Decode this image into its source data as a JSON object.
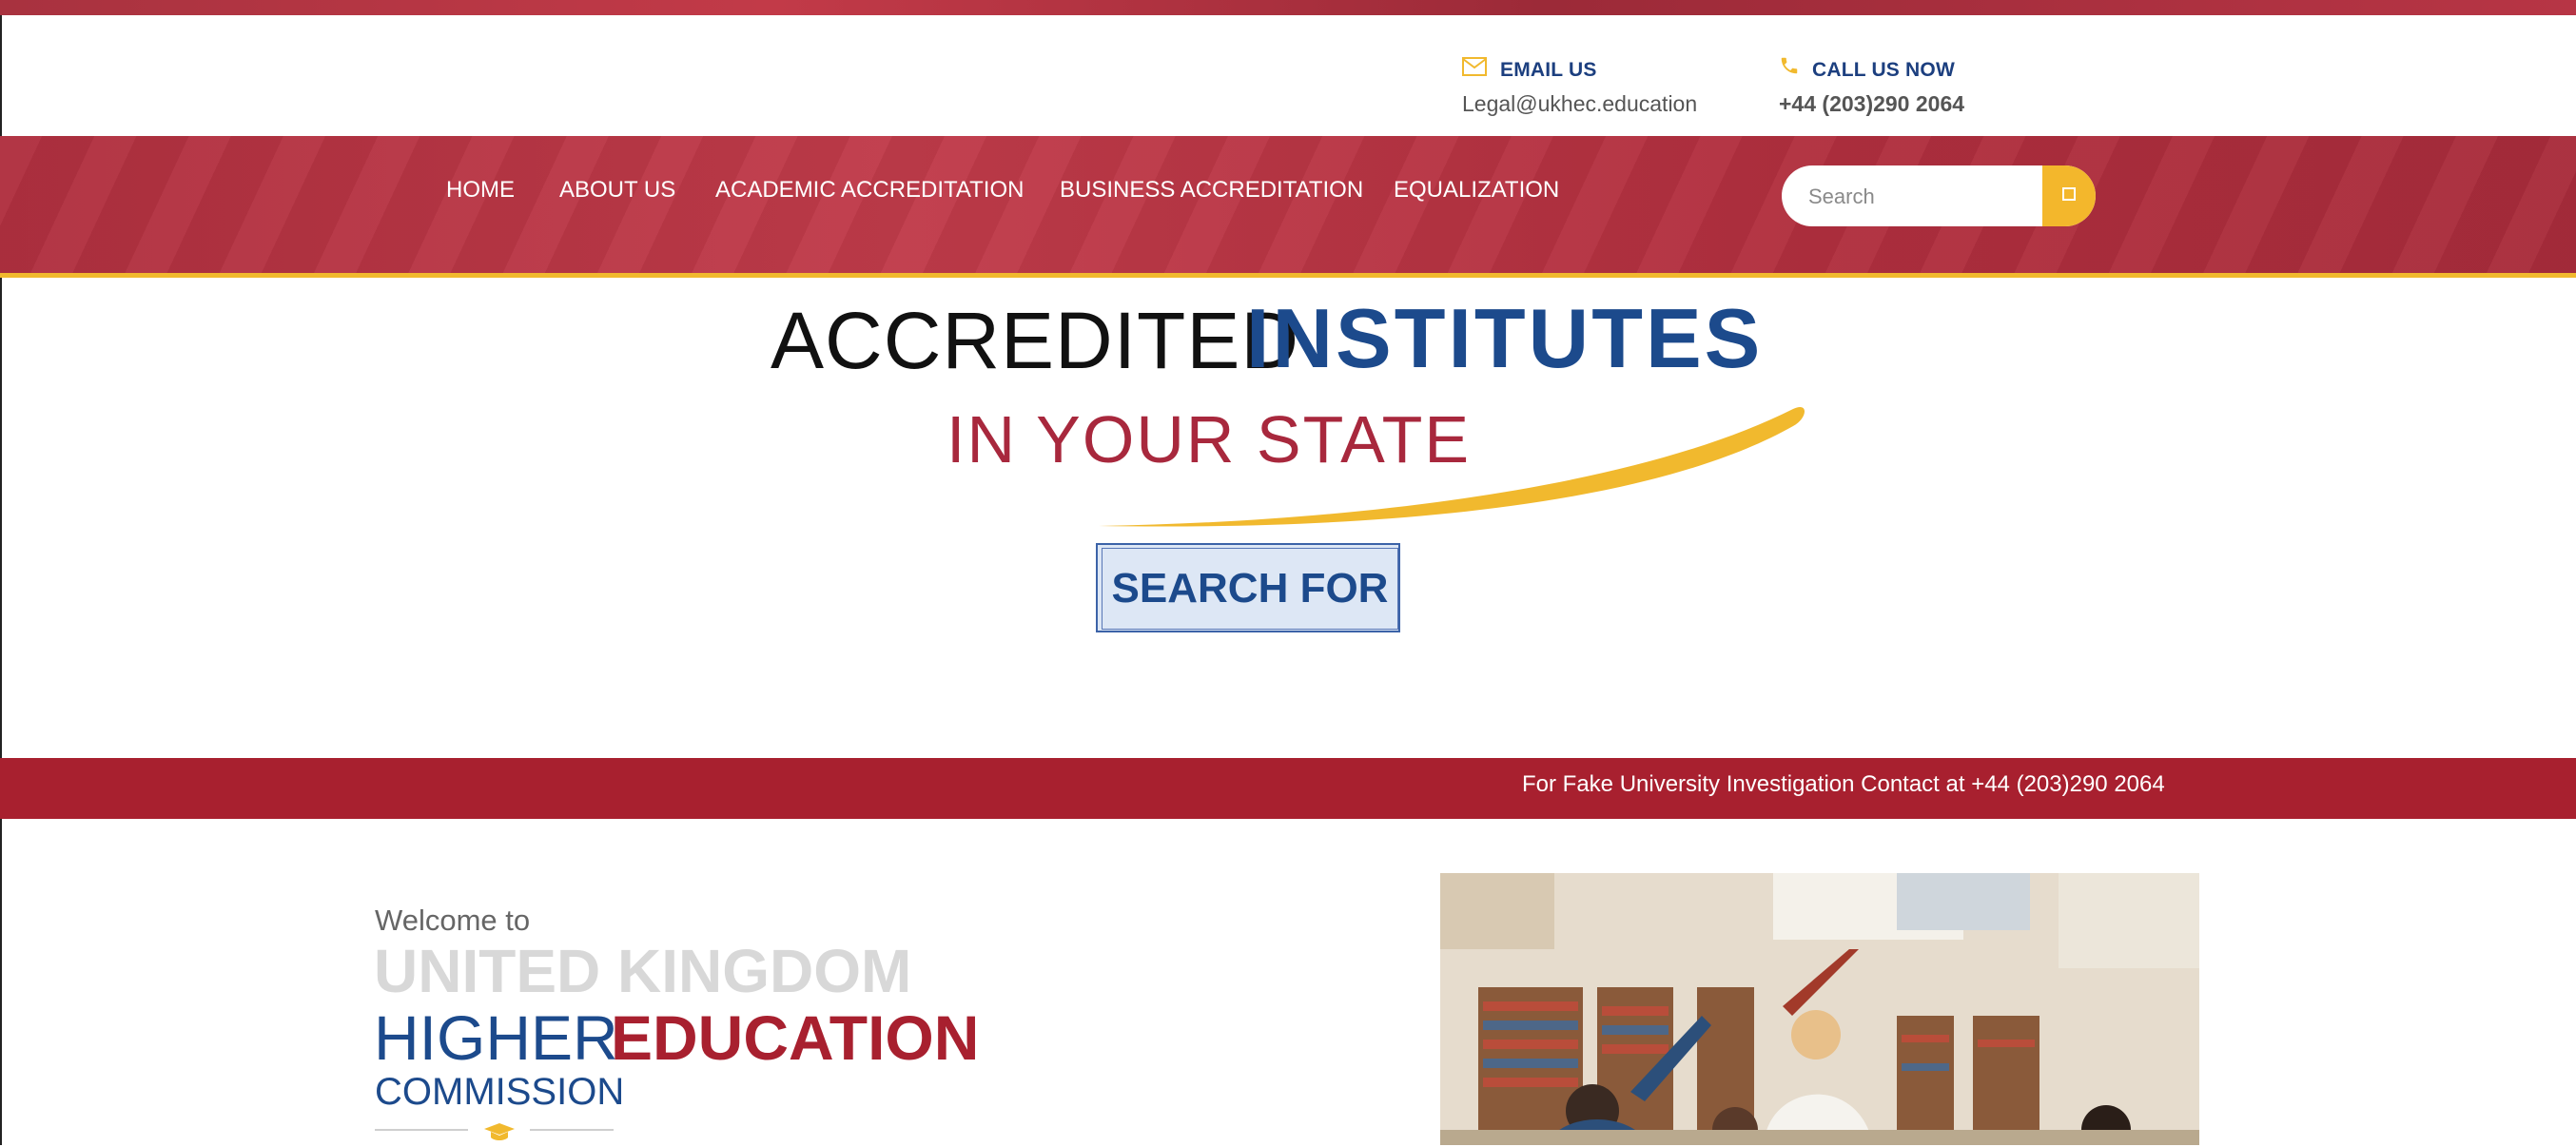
{
  "contact": {
    "email_label": "EMAIL US",
    "email_value": "Legal@ukhec.education",
    "phone_label": "CALL US NOW",
    "phone_value": "+44 (203)290 2064"
  },
  "nav": {
    "items": [
      {
        "label": "HOME"
      },
      {
        "label": "ABOUT US"
      },
      {
        "label": "ACADEMIC ACCREDITATION"
      },
      {
        "label": "BUSINESS ACCREDITATION"
      },
      {
        "label": "EQUALIZATION"
      }
    ],
    "search_placeholder": "Search"
  },
  "hero": {
    "line1_a": "ACCREDITED",
    "line1_b": "INSTITUTES",
    "line2": "IN YOUR STATE",
    "search_for": "SEARCH FOR"
  },
  "alert": {
    "text": "For Fake University Investigation Contact at +44 (203)290 2064"
  },
  "welcome": {
    "intro": "Welcome to",
    "line1": "UNITED KINGDOM",
    "line2_a": "HIGHER",
    "line2_b": "EDUCATION",
    "line3": "COMMISSION"
  },
  "colors": {
    "brand_red": "#a8202f",
    "brand_blue": "#1c4a8c",
    "accent_yellow": "#f3b72c"
  },
  "icons": [
    "envelope-icon",
    "phone-icon",
    "search-icon",
    "graduation-cap-icon"
  ]
}
